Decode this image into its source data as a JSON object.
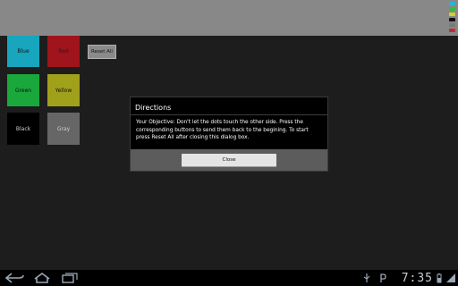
{
  "colors": {
    "indicators": [
      "#2ab3d6",
      "#2fbf3f",
      "#d6d02a",
      "#111111",
      "#7a7a7a",
      "#c22a33"
    ]
  },
  "buttons": {
    "blue": "Blue",
    "red": "Red",
    "green": "Green",
    "yellow": "Yellow",
    "black": "Black",
    "gray": "Gray",
    "reset": "Reset All"
  },
  "dialog": {
    "title": "Directions",
    "message": "Your Objective: Don't let the dots touch the other side. Press the corresponding buttons to send them back to the begining. To start press Reset All after closing this dialog box.",
    "close": "Close"
  },
  "statusbar": {
    "time": "7:35"
  }
}
